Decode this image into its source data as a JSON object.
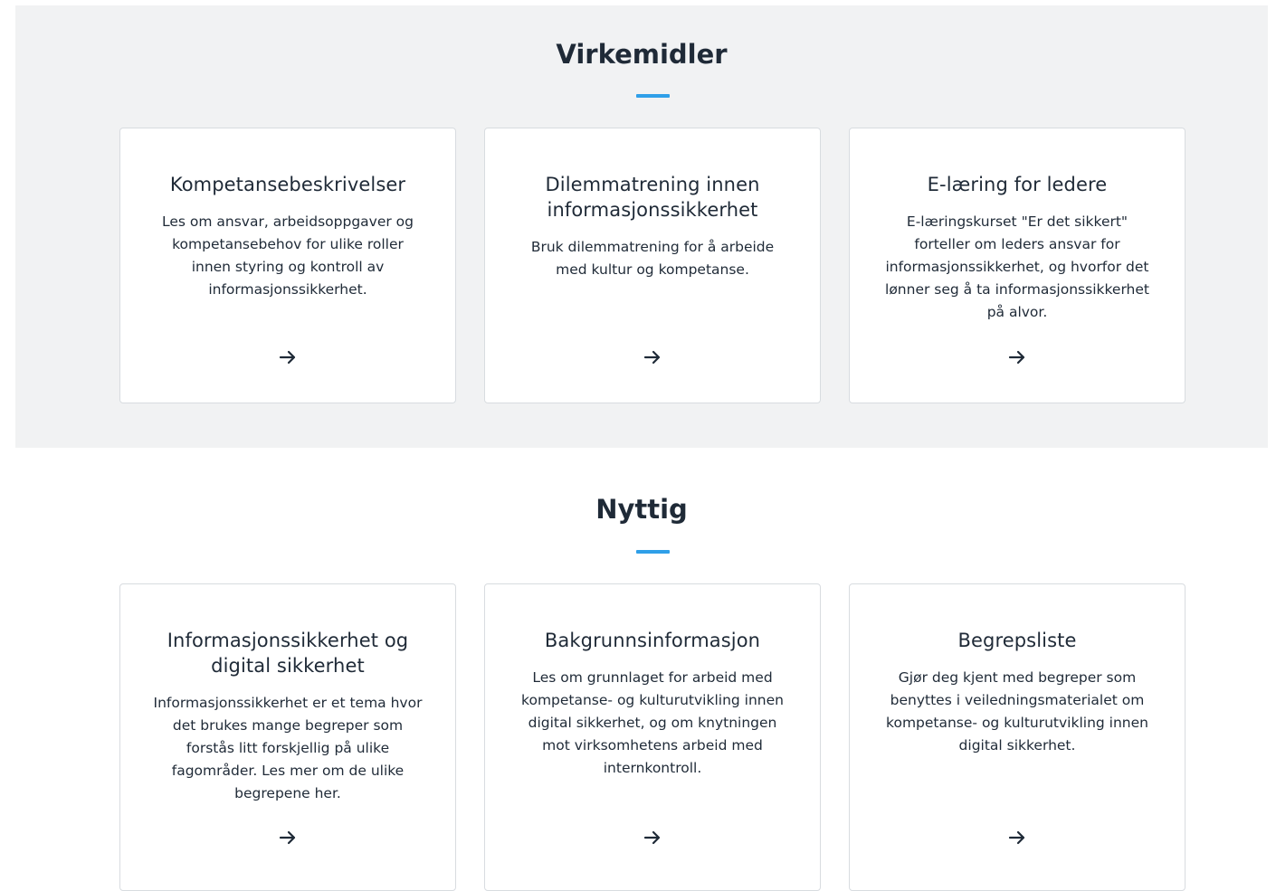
{
  "sections": [
    {
      "title": "Virkemidler",
      "cards": [
        {
          "title": "Kompetansebeskrivelser",
          "description": "Les om ansvar, arbeidsoppgaver og kompetansebehov for ulike roller innen styring og kontroll av informasjonssikkerhet.",
          "icon": "arrow-right-icon"
        },
        {
          "title": "Dilemmatrening innen informasjonssikkerhet",
          "description": "Bruk dilemmatrening for å arbeide med kultur og kompetanse.",
          "icon": "arrow-right-icon"
        },
        {
          "title": "E-læring for ledere",
          "description": "E-læringskurset \"Er det sikkert\" forteller om leders ansvar for informasjonssikkerhet, og hvorfor det lønner seg å ta informasjonssikkerhet på alvor.",
          "icon": "arrow-right-icon"
        }
      ]
    },
    {
      "title": "Nyttig",
      "cards": [
        {
          "title": "Informasjonssikkerhet og digital sikkerhet",
          "description": "Informasjonssikkerhet er et tema hvor det brukes mange begreper som forstås litt forskjellig på ulike fagområder. Les mer om de ulike begrepene her.",
          "icon": "arrow-right-icon"
        },
        {
          "title": "Bakgrunnsinformasjon",
          "description": "Les om grunnlaget for arbeid med kompetanse- og kulturutvikling innen digital sikkerhet, og om knytningen mot virksomhetens arbeid med internkontroll.",
          "icon": "arrow-right-icon"
        },
        {
          "title": "Begrepsliste",
          "description": "Gjør deg kjent med begreper som benyttes i veiledningsmaterialet om kompetanse- og kulturutvikling innen digital sikkerhet.",
          "icon": "arrow-right-icon"
        }
      ]
    }
  ],
  "colors": {
    "accent": "#2f9fe8",
    "text": "#1f2a37",
    "section_bg": "#f1f2f3",
    "card_border": "#d8dce0"
  }
}
